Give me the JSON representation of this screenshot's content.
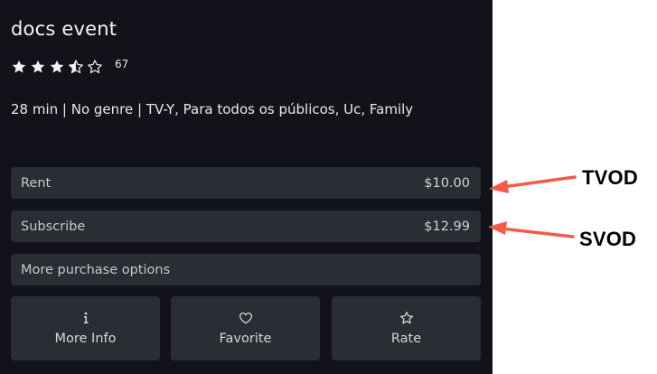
{
  "title": "docs event",
  "rating": {
    "stars_filled": 3.5,
    "stars_total": 5,
    "count": "67"
  },
  "meta": "28 min | No genre | TV-Y, Para todos os públicos, Uc, Family",
  "purchase_options": [
    {
      "label": "Rent",
      "price": "$10.00"
    },
    {
      "label": "Subscribe",
      "price": "$12.99"
    },
    {
      "label": "More purchase options"
    }
  ],
  "actions": [
    {
      "label": "More Info",
      "icon": "info-icon"
    },
    {
      "label": "Favorite",
      "icon": "heart-icon"
    },
    {
      "label": "Rate",
      "icon": "star-outline-icon"
    }
  ],
  "annotations": [
    {
      "label": "TVOD"
    },
    {
      "label": "SVOD"
    }
  ],
  "colors": {
    "panel_background": "#12131a",
    "button_background": "#2b2d34",
    "annotation_arrow": "#f25a4a"
  }
}
